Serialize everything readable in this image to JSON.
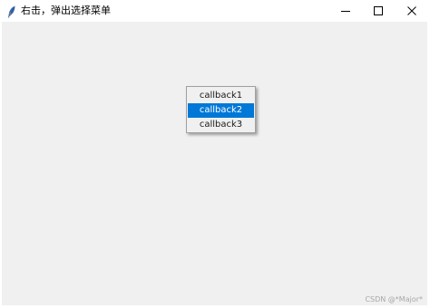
{
  "window": {
    "title": "右击，弹出选择菜单",
    "icon": "feather-icon"
  },
  "controls": {
    "minimize": "minimize-icon",
    "maximize": "maximize-icon",
    "close": "close-icon"
  },
  "popup_menu": {
    "items": [
      {
        "label": "callback1",
        "selected": false
      },
      {
        "label": "callback2",
        "selected": true
      },
      {
        "label": "callback3",
        "selected": false
      }
    ],
    "highlight_color": "#0078d7"
  },
  "watermark": "CSDN @*Major*"
}
